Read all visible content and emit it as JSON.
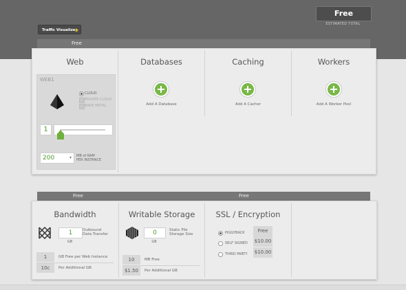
{
  "header": {
    "estimated_total": "Free",
    "estimated_total_label": "ESTIMATED TOTAL",
    "traffic_visualizer_label": "Traffic Visualizer"
  },
  "top_section": {
    "tier_label": "Free",
    "columns": {
      "web": {
        "title": "Web",
        "card_name": "WEB1",
        "radio_options": [
          {
            "label": "CLOUD",
            "selected": true
          },
          {
            "label": "PRIVATE CLOUD",
            "selected": false
          },
          {
            "label": "BARE METAL",
            "selected": false
          }
        ],
        "instances_value": "1",
        "ram_value": "200",
        "ram_unit_line1": "MB of RAM",
        "ram_unit_line2": "PER INSTANCE"
      },
      "databases": {
        "title": "Databases",
        "add_label": "Add A Database"
      },
      "caching": {
        "title": "Caching",
        "add_label": "Add A Cacher"
      },
      "workers": {
        "title": "Workers",
        "add_label": "Add A Worker Pool"
      }
    }
  },
  "bottom_section": {
    "tier_left": "Free",
    "tier_right": "Free",
    "bandwidth": {
      "title": "Bandwidth",
      "value": "1",
      "unit": "GB",
      "desc_line1": "Outbound",
      "desc_line2": "Data Transfer",
      "rows": [
        {
          "price": "1",
          "desc": "GB Free per Web Instance"
        },
        {
          "price": "10c",
          "desc": "Per Additional GB"
        }
      ]
    },
    "storage": {
      "title": "Writable Storage",
      "value": "0",
      "unit": "GB",
      "desc_line1": "Static File",
      "desc_line2": "Storage Size",
      "rows": [
        {
          "price": "10",
          "desc": "MB Free"
        },
        {
          "price": "$1.50",
          "desc": "Per Additional GB"
        }
      ]
    },
    "ssl": {
      "title": "SSL / Encryption",
      "options": [
        {
          "label": "PIGGYBACK",
          "price": "Free",
          "selected": true
        },
        {
          "label": "SELF SIGNED",
          "price": "$10.00",
          "selected": false
        },
        {
          "label": "THIRD PARTY",
          "price": "$10.00",
          "selected": false
        }
      ]
    }
  },
  "colors": {
    "accent_green": "#79b847",
    "dark_header": "#666666",
    "panel_bg": "#ececec"
  }
}
